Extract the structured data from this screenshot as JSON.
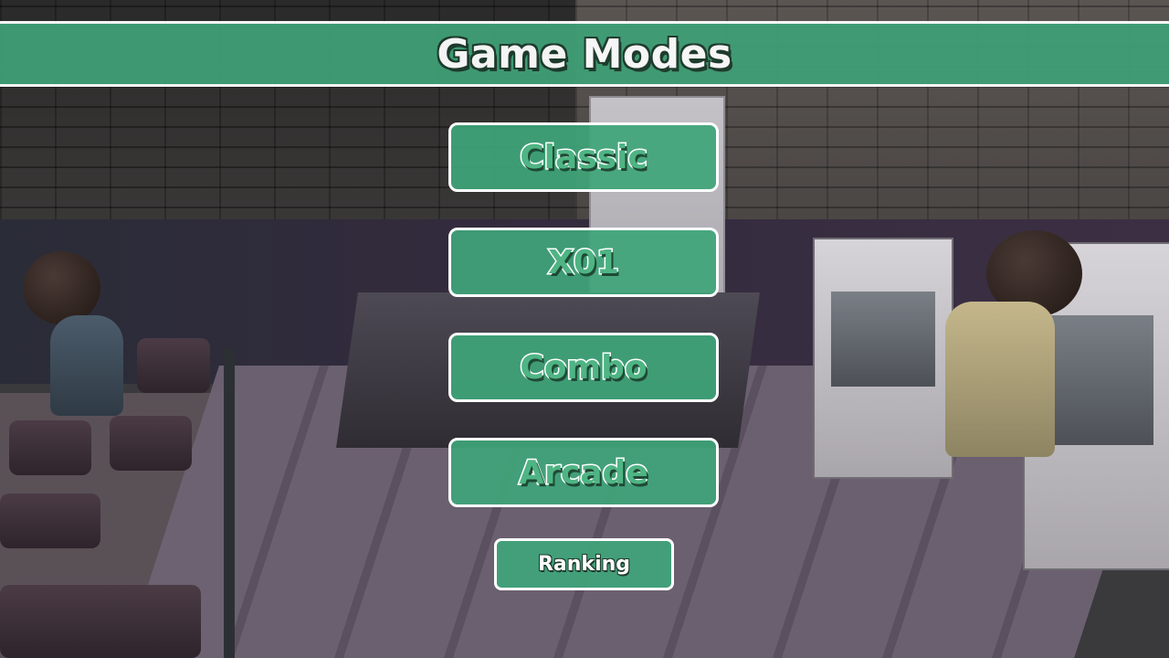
{
  "header": {
    "title": "Game Modes"
  },
  "menu": {
    "modes": [
      {
        "label": "Classic"
      },
      {
        "label": "X01"
      },
      {
        "label": "Combo"
      },
      {
        "label": "Arcade"
      }
    ],
    "ranking_label": "Ranking"
  },
  "colors": {
    "accent": "#3fa579",
    "title_bar": "#3f9f76",
    "border": "#ffffff"
  }
}
